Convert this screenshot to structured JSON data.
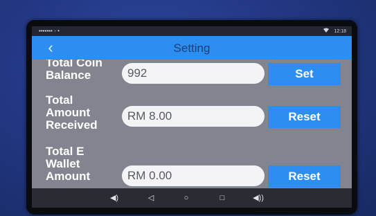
{
  "status_bar": {
    "left_icons": "▪▪▪▪▪▪▪ ◦ •",
    "time": "12:18",
    "wifi_icon": "wifi-icon"
  },
  "app_bar": {
    "back_glyph": "‹",
    "title": "Setting"
  },
  "rows": [
    {
      "label_lines": [
        "Total Coin",
        "Balance"
      ],
      "value": "992",
      "button": "Set"
    },
    {
      "label_lines": [
        "Total",
        "Amount",
        "Received"
      ],
      "value": "RM 8.00",
      "button": "Reset"
    },
    {
      "label_lines": [
        "Total E",
        "Wallet",
        "Amount"
      ],
      "value": "RM 0.00",
      "button": "Reset"
    }
  ],
  "nav_bar": {
    "volume_down_glyph": "◀)",
    "back_glyph": "◁",
    "home_glyph": "○",
    "recents_glyph": "□",
    "volume_up_glyph": "◀))"
  },
  "colors": {
    "accent": "#2c8ef0",
    "screen_bg": "#828590",
    "field_bg": "#f4f4f6",
    "panel": "#223884"
  }
}
